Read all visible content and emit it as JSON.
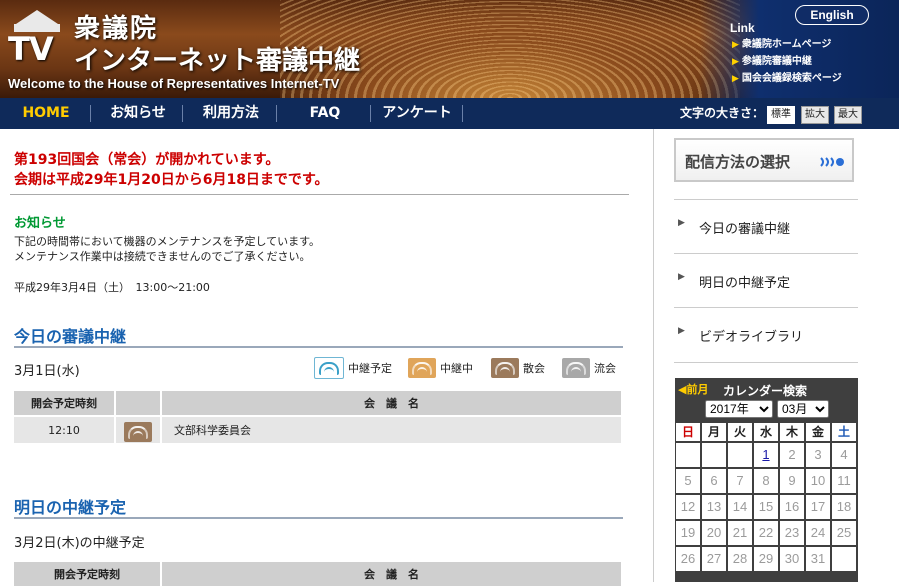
{
  "header": {
    "logo_tv": "TV",
    "title_line1": "衆議院",
    "title_line2": "インターネット審議中継",
    "subtitle": "Welcome to the House of Representatives Internet-TV",
    "english_button": "English",
    "link_title": "Link",
    "links": [
      "衆議院ホームページ",
      "参議院審議中継",
      "国会会議録検索ページ"
    ]
  },
  "nav": {
    "items": [
      "HOME",
      "お知らせ",
      "利用方法",
      "FAQ",
      "アンケート"
    ],
    "font_size_label": "文字の大きさ：",
    "font_size_buttons": [
      "標準",
      "拡大",
      "最大"
    ]
  },
  "notice": {
    "line1": "第193回国会（常会）が開かれています。",
    "line2": "会期は平成29年1月20日から6月18日までです。"
  },
  "info": {
    "title": "お知らせ",
    "line1": "下記の時間帯において機器のメンテナンスを予定しています。",
    "line2": "メンテナンス作業中は接続できませんのでご了承ください。",
    "date": "平成29年3月4日（土）　13:00～21:00"
  },
  "today": {
    "title": "今日の審議中継",
    "date": "3月1日(水)",
    "legend": [
      "中継予定",
      "中継中",
      "散会",
      "流会"
    ],
    "table_headers": [
      "開会予定時刻",
      "",
      "会　議　名"
    ],
    "rows": [
      {
        "time": "12:10",
        "status_icon": "adjourned-icon",
        "name": "文部科学委員会"
      }
    ]
  },
  "tomorrow": {
    "title": "明日の中継予定",
    "date": "3月2日(木)の中継予定",
    "table_headers": [
      "開会予定時刻",
      "会　議　名"
    ]
  },
  "sidebar": {
    "method_button": "配信方法の選択",
    "menu": [
      "今日の審議中継",
      "明日の中継予定",
      "ビデオライブラリ"
    ]
  },
  "calendar": {
    "prev": "◀前月",
    "title": "カレンダー検索",
    "year": "2017年",
    "month": "03月",
    "weekdays": [
      "日",
      "月",
      "火",
      "水",
      "木",
      "金",
      "土"
    ],
    "weeks": [
      [
        "",
        "",
        "",
        "1",
        "2",
        "3",
        "4"
      ],
      [
        "5",
        "6",
        "7",
        "8",
        "9",
        "10",
        "11"
      ],
      [
        "12",
        "13",
        "14",
        "15",
        "16",
        "17",
        "18"
      ],
      [
        "19",
        "20",
        "21",
        "22",
        "23",
        "24",
        "25"
      ],
      [
        "26",
        "27",
        "28",
        "29",
        "30",
        "31",
        ""
      ]
    ],
    "linked_day": "1"
  },
  "colors": {
    "nav_bg": "#0f2a5a",
    "home_active": "#ffcc00",
    "notice_red": "#cc0000",
    "section_blue": "#1a63b0",
    "info_green": "#009933"
  }
}
